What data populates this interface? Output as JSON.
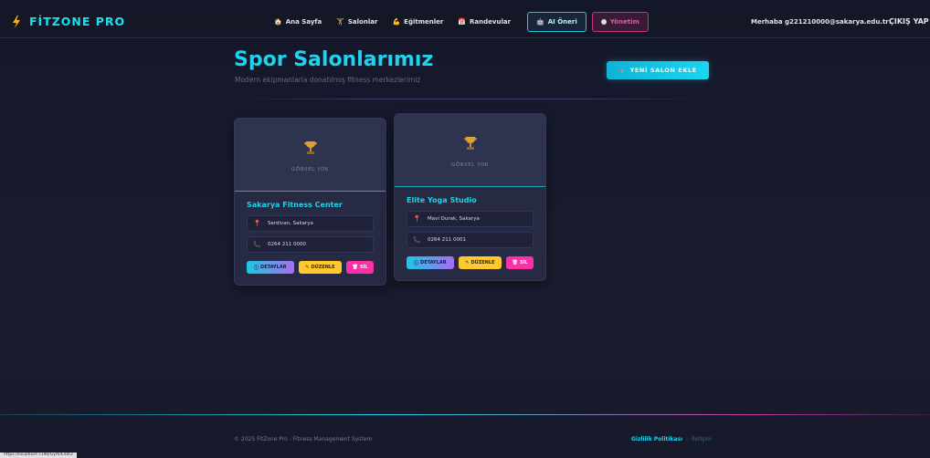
{
  "navbar": {
    "brand": "FİTZONE PRO",
    "links": [
      {
        "icon": "🏠",
        "label": "Ana Sayfa"
      },
      {
        "icon": "🏋",
        "label": "Salonlar"
      },
      {
        "icon": "💪",
        "label": "Eğitmenler"
      },
      {
        "icon": "📅",
        "label": "Randevular"
      }
    ],
    "ai_link": {
      "icon": "🤖",
      "label": "AI Öneri"
    },
    "admin_link": {
      "label": "Yönetim"
    },
    "greeting": "Merhaba g221210000@sakarya.edu.tr!",
    "logout": "ÇIKIŞ YAP"
  },
  "header": {
    "title": "Spor Salonlarımız",
    "subtitle": "Modern ekipmanlarla donatılmış fitness merkezlerimiz",
    "add_button": "YENİ SALON EKLE"
  },
  "gyms": [
    {
      "no_image_label": "GÖRSEL YOK",
      "name": "Sakarya Fitness Center",
      "location": "Serdivan, Sakarya",
      "phone": "0264 211 0000",
      "details_label": "DETAYLAR",
      "edit_label": "DÜZENLE",
      "delete_label": "SİL"
    },
    {
      "no_image_label": "GÖRSEL YOK",
      "name": "Elite Yoga Studio",
      "location": "Mavi Durak, Sakarya",
      "phone": "0264 211 0001",
      "details_label": "DETAYLAR",
      "edit_label": "DÜZENLE",
      "delete_label": "SİL"
    }
  ],
  "footer": {
    "copyright": "© 2025 FitZone Pro - Fitness Management System",
    "privacy": "Gizlilik Politikası",
    "separator": "|",
    "contact": "İletişim"
  },
  "status_bar": "https://localhost:7190/Gym/Edit/2",
  "colors": {
    "accent": "#1fd3ec",
    "background": "#171a2b",
    "card": "#262a42",
    "edit": "#ffc82e",
    "delete": "#ff2fa6"
  }
}
